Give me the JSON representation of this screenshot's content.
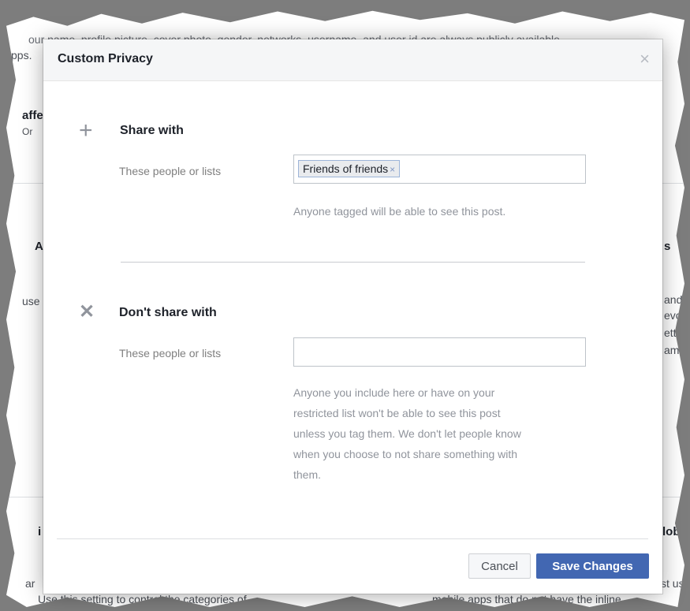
{
  "background": {
    "top_text": "our name, profile picture, cover photo, gender, networks, username, and user id are always publicly available",
    "top_text_2": "pps.",
    "left_fragment_1": "affe",
    "left_fragment_1b": "Or",
    "left_fragment_2": "A",
    "left_fragment_3": "use",
    "right_fragment_1": "s",
    "right_fragment_2": "and p",
    "right_fragment_3": "evc",
    "right_fragment_4": "ettir",
    "right_fragment_5": "ame,",
    "left_fragment_4": "i",
    "right_fragment_6": "lob",
    "left_fragment_5": "ar",
    "right_fragment_7": "st us",
    "bottom_text_1": "Use this setting to control the categories of",
    "bottom_text_2": "mobile apps that do not have the inline"
  },
  "modal": {
    "title": "Custom Privacy",
    "close_glyph": "×",
    "share": {
      "icon_glyph": "+",
      "title": "Share with",
      "label": "These people or lists",
      "token_label": "Friends of friends",
      "token_remove_glyph": "×",
      "helper": "Anyone tagged will be able to see this post."
    },
    "dont_share": {
      "icon_glyph": "✕",
      "title": "Don't share with",
      "label": "These people or lists",
      "input_value": "",
      "helper_lines": [
        "Anyone you include here or have on your",
        "restricted list won't be able to see this post",
        "unless you tag them. We don't let people know",
        "when you choose to not share something with",
        "them."
      ]
    },
    "buttons": {
      "cancel": "Cancel",
      "save": "Save Changes"
    }
  },
  "colors": {
    "primary": "#4267b2",
    "header_bg": "#f5f6f7"
  }
}
